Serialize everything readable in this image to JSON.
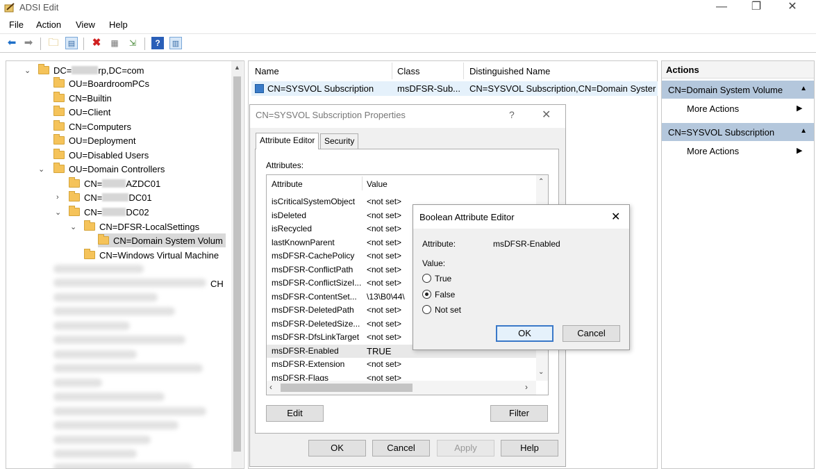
{
  "window": {
    "title": "ADSI Edit",
    "minimize": "—",
    "restore": "❐",
    "close": "✕"
  },
  "menu": [
    "File",
    "Action",
    "View",
    "Help"
  ],
  "toolbar_icons": [
    "back-icon",
    "forward-icon",
    "up-folder-icon",
    "show-hide-tree-icon",
    "delete-icon",
    "properties-icon",
    "export-icon",
    "help-icon",
    "show-hide-action-icon"
  ],
  "tree": {
    "root_pre": "DC=",
    "root_post": "rp,DC=com",
    "items": [
      "OU=BoardroomPCs",
      "CN=Builtin",
      "OU=Client",
      "CN=Computers",
      "OU=Deployment",
      "OU=Disabled Users",
      "OU=Domain Controllers"
    ],
    "dc1_pre": "CN=",
    "dc1_post": "AZDC01",
    "dc2_pre": "CN=",
    "dc2_post": "DC01",
    "dc3_pre": "CN=",
    "dc3_post": "DC02",
    "dfsr": "CN=DFSR-LocalSettings",
    "sysvol": "CN=Domain System Volum",
    "vm": "CN=Windows Virtual Machine",
    "partial_suffix": "CH"
  },
  "list": {
    "headers": {
      "name": "Name",
      "class": "Class",
      "dn": "Distinguished Name"
    },
    "row": {
      "name": "CN=SYSVOL Subscription",
      "class": "msDFSR-Sub...",
      "dn": "CN=SYSVOL Subscription,CN=Domain Syster"
    }
  },
  "actions": {
    "header": "Actions",
    "section1": "CN=Domain System Volume",
    "more1": "More Actions",
    "section2": "CN=SYSVOL Subscription",
    "more2": "More Actions"
  },
  "properties": {
    "title": "CN=SYSVOL Subscription Properties",
    "help_glyph": "?",
    "tabs": [
      "Attribute Editor",
      "Security"
    ],
    "attributes_label": "Attributes:",
    "col_attribute": "Attribute",
    "col_value": "Value",
    "rows": [
      {
        "a": "isCriticalSystemObject",
        "v": "<not set>"
      },
      {
        "a": "isDeleted",
        "v": "<not set>"
      },
      {
        "a": "isRecycled",
        "v": "<not set>"
      },
      {
        "a": "lastKnownParent",
        "v": "<not set>"
      },
      {
        "a": "msDFSR-CachePolicy",
        "v": "<not set>"
      },
      {
        "a": "msDFSR-ConflictPath",
        "v": "<not set>"
      },
      {
        "a": "msDFSR-ConflictSizeI...",
        "v": "<not set>"
      },
      {
        "a": "msDFSR-ContentSet...",
        "v": "\\13\\B0\\44\\"
      },
      {
        "a": "msDFSR-DeletedPath",
        "v": "<not set>"
      },
      {
        "a": "msDFSR-DeletedSize...",
        "v": "<not set>"
      },
      {
        "a": "msDFSR-DfsLinkTarget",
        "v": "<not set>"
      },
      {
        "a": "msDFSR-Enabled",
        "v": "TRUE"
      },
      {
        "a": "msDFSR-Extension",
        "v": "<not set>"
      },
      {
        "a": "msDFSR-Flags",
        "v": "<not set>"
      }
    ],
    "edit": "Edit",
    "filter": "Filter",
    "ok": "OK",
    "cancel": "Cancel",
    "apply": "Apply",
    "help": "Help"
  },
  "boolean_editor": {
    "title": "Boolean Attribute Editor",
    "attribute_label": "Attribute:",
    "attribute_value": "msDFSR-Enabled",
    "value_label": "Value:",
    "options": [
      "True",
      "False",
      "Not set"
    ],
    "selected": "False",
    "ok": "OK",
    "cancel": "Cancel"
  }
}
